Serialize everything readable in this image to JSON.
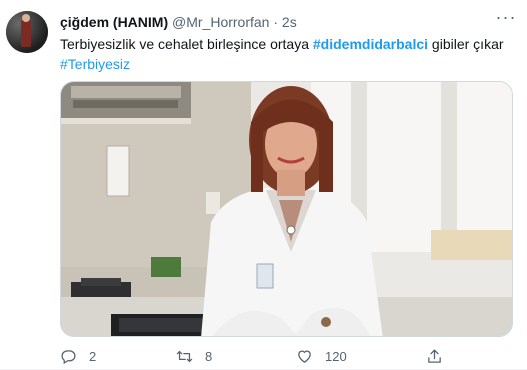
{
  "tweet": {
    "display_name": "çiğdem (HANIM)",
    "handle": "@Mr_Horrorfan",
    "separator": "·",
    "time": "2s",
    "more_icon": "more-horizontal-icon",
    "text_before": "Terbiyesizlik ve cehalet birleşince ortaya ",
    "hashtag_1": "#didemdidarbalci",
    "text_middle": " gibiler çıkar",
    "hashtag_2": "#Terbiyesiz",
    "hashtag_color": "#1d9bf0",
    "actions": {
      "reply_count": "2",
      "retweet_count": "8",
      "like_count": "120",
      "reply_icon": "reply-icon",
      "retweet_icon": "retweet-icon",
      "like_icon": "heart-icon",
      "share_icon": "share-icon"
    }
  }
}
